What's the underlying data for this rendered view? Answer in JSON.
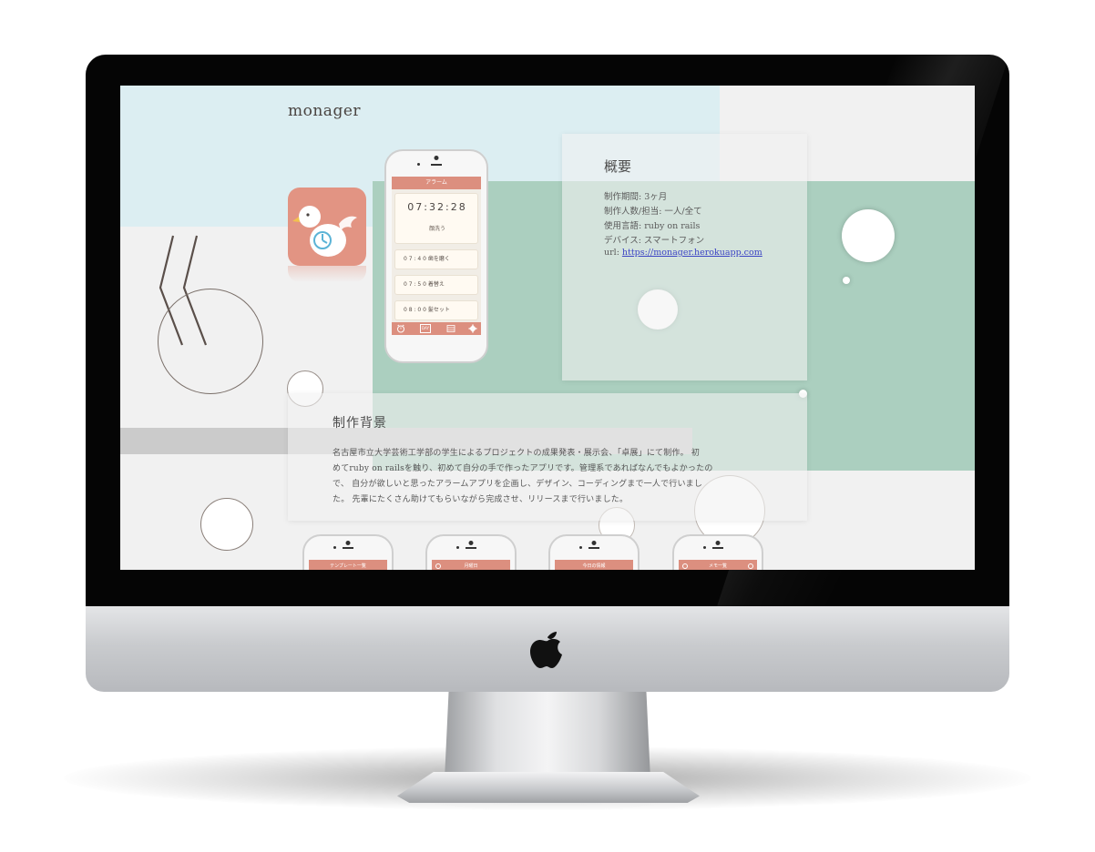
{
  "site": {
    "logo": "monager"
  },
  "phone": {
    "header_title": "アラーム",
    "clock_time": "07:32:28",
    "clock_subtitle": "顔洗う",
    "alarms": [
      "0 7 : 4 0 歯を磨く",
      "0 7 : 5 0 着替え",
      "0 8 : 0 0 髪セット"
    ],
    "tab_icons": [
      "alarm-clock-icon",
      "calendar-day-icon",
      "list-icon",
      "gear-icon"
    ],
    "tab_labels": {
      "day": "DAY"
    }
  },
  "overview": {
    "title": "概要",
    "lines": [
      "制作期間: 3ヶ月",
      "制作人数/担当: 一人/全て",
      "使用言語: ruby on rails",
      "デバイス: スマートフォン"
    ],
    "url_label": "url: ",
    "url_link": "https://monager.herokuapp.com"
  },
  "background": {
    "title": "制作背景",
    "lines": [
      "名古屋市立大学芸術工学部の学生によるプロジェクトの成果発表・展示会、「卓展」にて制作。 初",
      "めてruby on railsを触り、初めて自分の手で作ったアプリです。管理系であればなんでもよかったの",
      "で、 自分が欲しいと思ったアラームアプリを企画し、デザイン、コーディングまで一人で行いまし",
      "た。 先輩にたくさん助けてもらいながら完成させ、リリースまで行いました。"
    ]
  },
  "screenshots": [
    {
      "header": "テンプレート一覧"
    },
    {
      "header": "月曜日"
    },
    {
      "header": "今日の情報"
    },
    {
      "header": "メモ一覧"
    }
  ],
  "colors": {
    "accent": "#dc8f7f",
    "app_icon": "#e29483",
    "green": "#abcfbf",
    "light_blue": "#dceef2",
    "link": "#3b43c4"
  }
}
